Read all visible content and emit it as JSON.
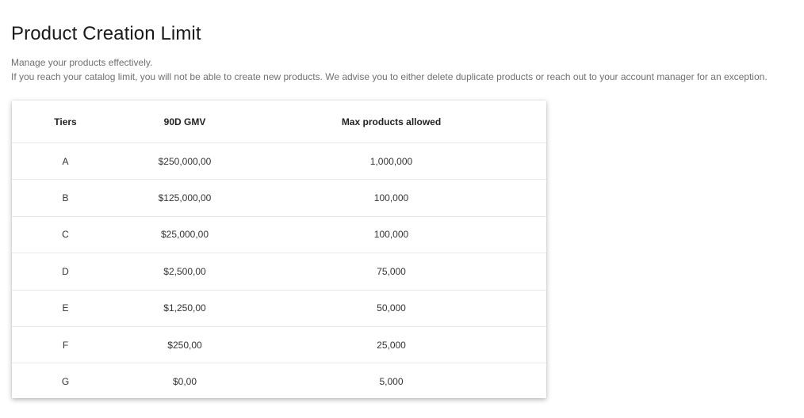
{
  "page": {
    "title": "Product Creation Limit",
    "description_line1": "Manage your products effectively.",
    "description_line2": "If you reach your catalog limit, you will not be able to create new products. We advise you to either delete duplicate products or reach out to your account manager for an exception."
  },
  "table": {
    "headers": {
      "tier": "Tiers",
      "gmv": "90D GMV",
      "max": "Max products allowed"
    },
    "rows": [
      {
        "tier": "A",
        "gmv": "$250,000,00",
        "max": "1,000,000"
      },
      {
        "tier": "B",
        "gmv": "$125,000,00",
        "max": "100,000"
      },
      {
        "tier": "C",
        "gmv": "$25,000,00",
        "max": "100,000"
      },
      {
        "tier": "D",
        "gmv": "$2,500,00",
        "max": "75,000"
      },
      {
        "tier": "E",
        "gmv": "$1,250,00",
        "max": "50,000"
      },
      {
        "tier": "F",
        "gmv": "$250,00",
        "max": "25,000"
      },
      {
        "tier": "G",
        "gmv": "$0,00",
        "max": "5,000"
      }
    ]
  }
}
